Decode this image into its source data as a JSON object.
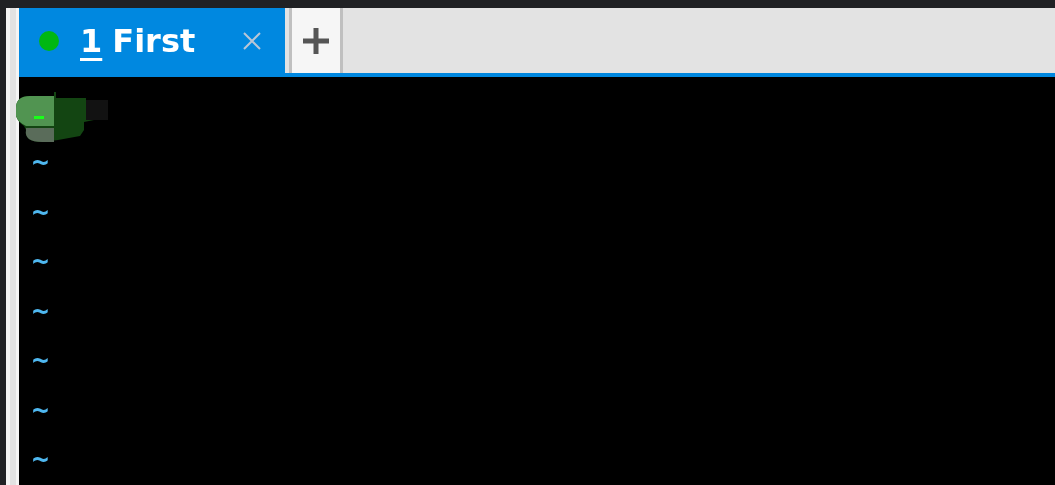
{
  "tabs": [
    {
      "number": "1",
      "title": "First",
      "selected": true,
      "color": "#00b712"
    }
  ],
  "terminal": {
    "lines": [
      "~",
      "~",
      "~",
      "~",
      "~",
      "~",
      "~"
    ]
  }
}
